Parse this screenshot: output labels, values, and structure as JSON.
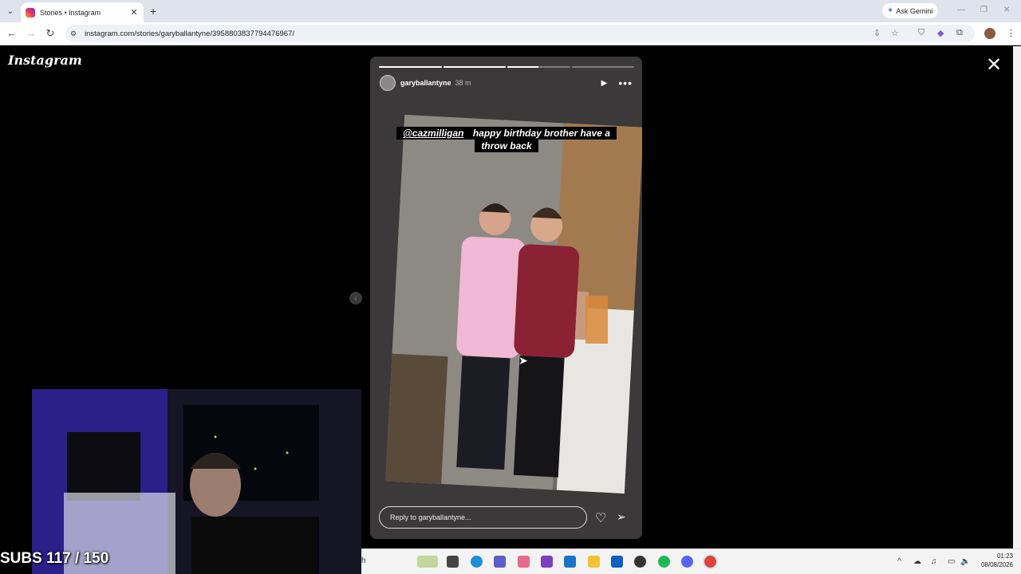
{
  "browser": {
    "tab_title": "Stories • Instagram",
    "tab_close": "✕",
    "new_tab": "+",
    "gemini_label": "Ask Gemini",
    "url": "instagram.com/stories/garyballantyne/3958803837794476967/"
  },
  "instagram": {
    "logo": "Instagram",
    "close": "✕"
  },
  "story": {
    "username": "garyballantyne",
    "time_ago": "38 m",
    "progress": [
      1.0,
      1.0,
      0.5,
      0.0
    ],
    "caption_mention": "@cazmilligan",
    "caption_text": " happy birthday brother have a throw back",
    "reply_placeholder": "Reply to garyballantyne..."
  },
  "overlay": {
    "subs": "SUBS 117 / 150"
  },
  "taskbar": {
    "time": "01:23",
    "date": "08/08/2026",
    "search_fragment": "h"
  },
  "icons": {
    "back": "arrow-left-icon",
    "forward": "arrow-right-icon",
    "reload": "reload-icon",
    "heart": "heart-icon",
    "send": "send-icon",
    "more": "more-icon",
    "play": "play-icon"
  }
}
